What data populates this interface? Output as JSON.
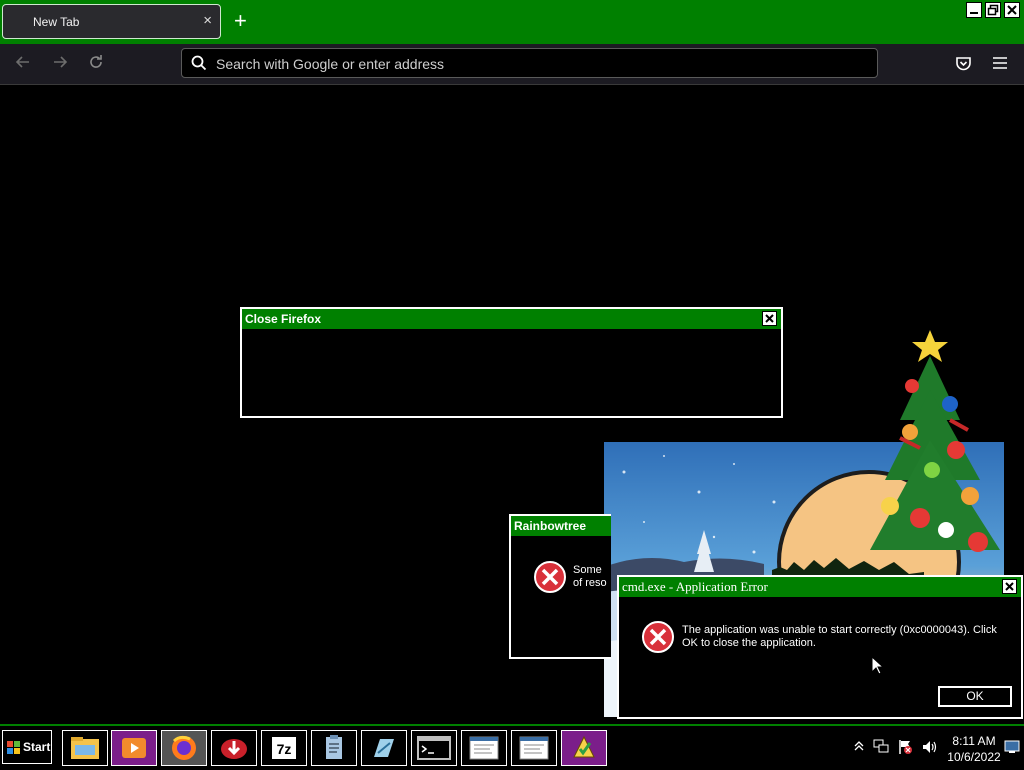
{
  "browser": {
    "tab_title": "New Tab",
    "tab_close": "×",
    "new_tab": "+",
    "url_placeholder": "Search with Google or enter address",
    "window_controls": [
      "minimize",
      "restore",
      "close"
    ]
  },
  "icons": {
    "back": "back-arrow-icon",
    "forward": "forward-arrow-icon",
    "reload": "reload-icon",
    "search": "search-icon",
    "pocket": "pocket-icon",
    "menu": "hamburger-menu-icon"
  },
  "dialogs": {
    "close_firefox": {
      "title": "Close Firefox"
    },
    "rainbowtree": {
      "title": "Rainbowtree",
      "message_line1": "Some",
      "message_line2": "of reso"
    },
    "cmd_error": {
      "title": "cmd.exe - Application Error",
      "message": "The application was unable to start correctly (0xc0000043). Click OK to close the application.",
      "ok_label": "OK"
    }
  },
  "taskbar": {
    "start_label": "Start",
    "buttons": [
      "file-explorer-icon",
      "media-player-icon",
      "firefox-icon",
      "download-icon",
      "7zip-icon",
      "clipboard-icon",
      "notepad-icon",
      "command-prompt-icon",
      "window-icon",
      "window-icon-2",
      "security-shield-icon"
    ],
    "tray": {
      "time": "8:11 AM",
      "date": "10/6/2022"
    }
  },
  "colors": {
    "accent": "#008000",
    "background": "#000000",
    "error_red": "#d9303a"
  }
}
